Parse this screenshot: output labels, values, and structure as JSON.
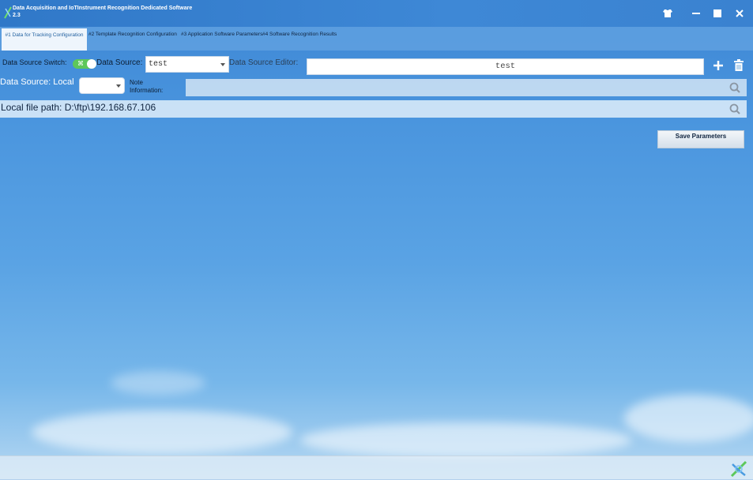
{
  "window": {
    "title_line1": "Data Acquisition and IoTInstrument Recognition Dedicated Software",
    "title_line2": "2.3",
    "controls": [
      "skin-icon",
      "minimize-icon",
      "maximize-icon",
      "close-icon"
    ]
  },
  "tabs": [
    {
      "label": "#1 Data for Tracking Configuration",
      "active": true
    },
    {
      "label": "#2 Template Recognition Configuration",
      "active": false
    },
    {
      "label": "#3 Application Software Parameters",
      "active": false
    },
    {
      "label": "#4 Software Recognition Results",
      "active": false
    }
  ],
  "form": {
    "switch_label": "Data Source Switch:",
    "switch_on": true,
    "source_label": "Data Source:",
    "source_value": "test",
    "editor_label": "Data Source Editor:",
    "editor_value": "test",
    "local_label": "Data Source: Local",
    "local_value": "",
    "note_label_1": "Note",
    "note_label_2": "Information:",
    "note_value": "",
    "path_label": "Local file path: D:\\ftp\\192.168.67.106",
    "save_label": "Save Parameters"
  },
  "colors": {
    "accent": "#3a82d0",
    "toggle_on": "#5ec75a",
    "active_tab_text": "#1f5f9f"
  }
}
